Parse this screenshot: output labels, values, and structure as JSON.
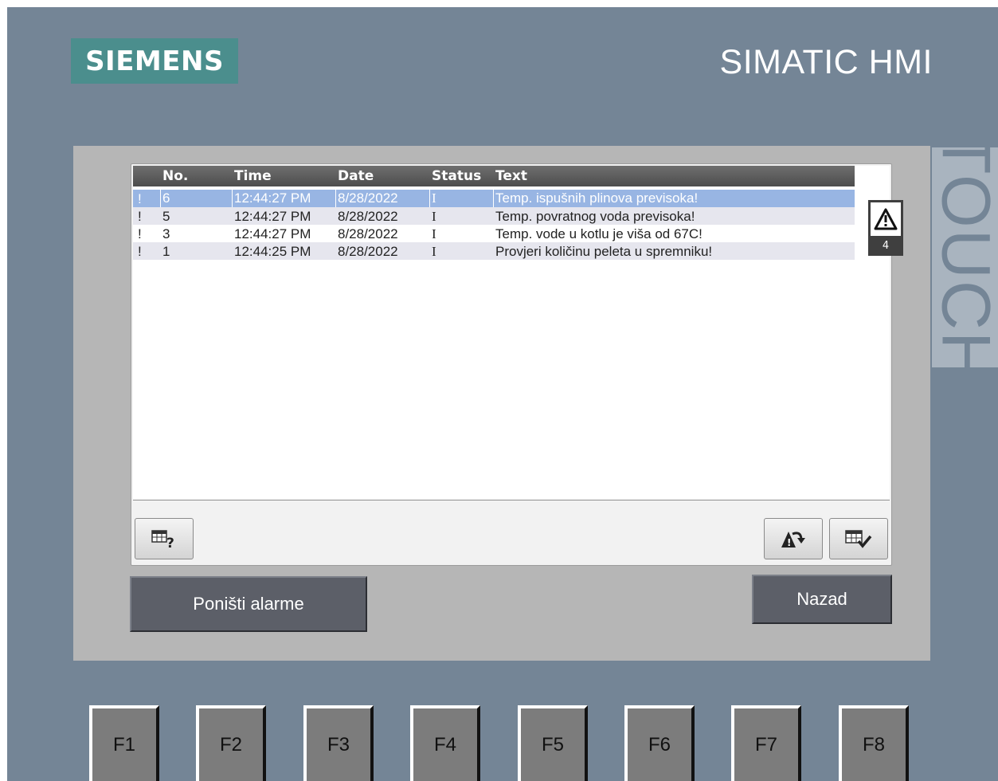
{
  "header": {
    "logo_text": "SIEMENS",
    "brand_text": "SIMATIC HMI",
    "side_label": "TOUCH"
  },
  "alarm_table": {
    "columns": [
      "No.",
      "Time",
      "Date",
      "Status",
      "Text"
    ],
    "rows": [
      {
        "flag": "!",
        "no": "6",
        "time": "12:44:27 PM",
        "date": "8/28/2022",
        "status": "I",
        "text": "Temp. ispušnih plinova previsoka!",
        "selected": true
      },
      {
        "flag": "!",
        "no": "5",
        "time": "12:44:27 PM",
        "date": "8/28/2022",
        "status": "I",
        "text": "Temp. povratnog voda previsoka!",
        "selected": false
      },
      {
        "flag": "!",
        "no": "3",
        "time": "12:44:27 PM",
        "date": "8/28/2022",
        "status": "I",
        "text": "Temp. vode u kotlu je viša od 67C!",
        "selected": false
      },
      {
        "flag": "!",
        "no": "1",
        "time": "12:44:25 PM",
        "date": "8/28/2022",
        "status": "I",
        "text": "Provjeri količinu peleta u spremniku!",
        "selected": false
      }
    ]
  },
  "warning_indicator": {
    "icon": "warning-triangle-icon",
    "count": "4"
  },
  "toolbar": {
    "info_icon": "table-info-icon",
    "loop_icon": "alarm-loop-icon",
    "ack_icon": "table-acknowledge-icon"
  },
  "buttons": {
    "reset_alarms": "Poništi alarme",
    "back": "Nazad"
  },
  "function_keys": [
    "F1",
    "F2",
    "F3",
    "F4",
    "F5",
    "F6",
    "F7",
    "F8"
  ],
  "colors": {
    "bezel": "#748596",
    "screen": "#b6b6b6",
    "logo": "#4b8e8d",
    "selected_row": "#98b5e3"
  }
}
